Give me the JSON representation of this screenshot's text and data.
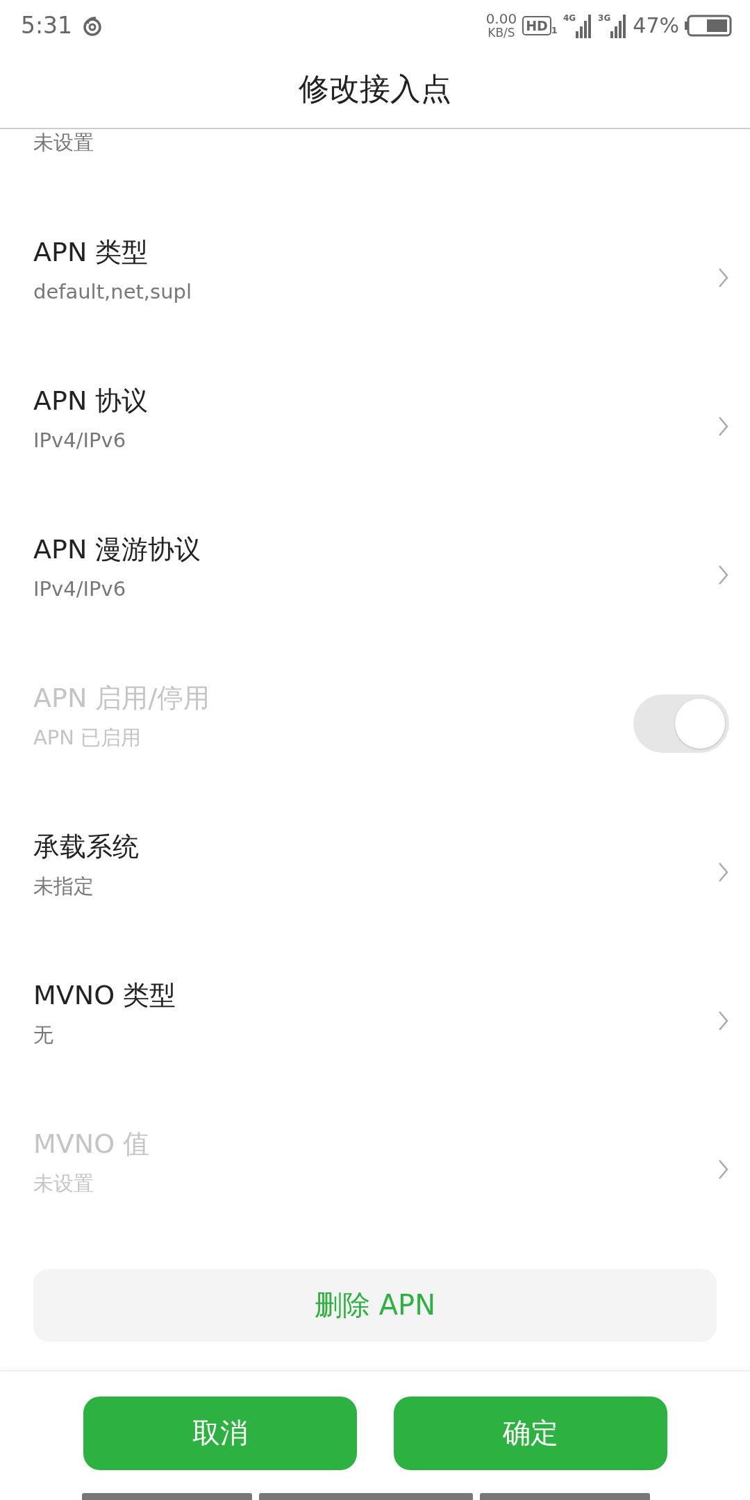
{
  "status_bar": {
    "time": "5:31",
    "speed_value": "0.00",
    "speed_unit": "KB/S",
    "hd": "HD",
    "hd_sim": "1",
    "signals": [
      {
        "label": "4G"
      },
      {
        "label": "3G"
      }
    ],
    "battery": "47%"
  },
  "title": "修改接入点",
  "items": [
    {
      "kind": "partial",
      "subtitle": "未设置",
      "disabled": false
    },
    {
      "kind": "chevron",
      "title": "APN 类型",
      "subtitle": "default,net,supl",
      "disabled": false
    },
    {
      "kind": "chevron",
      "title": "APN 协议",
      "subtitle": "IPv4/IPv6",
      "disabled": false
    },
    {
      "kind": "chevron",
      "title": "APN 漫游协议",
      "subtitle": "IPv4/IPv6",
      "disabled": false
    },
    {
      "kind": "toggle",
      "title": "APN 启用/停用",
      "subtitle": "APN 已启用",
      "disabled": true,
      "on": true
    },
    {
      "kind": "chevron",
      "title": "承载系统",
      "subtitle": "未指定",
      "disabled": false
    },
    {
      "kind": "chevron",
      "title": "MVNO 类型",
      "subtitle": "无",
      "disabled": false
    },
    {
      "kind": "chevron",
      "title": "MVNO 值",
      "subtitle": "未设置",
      "disabled": true
    }
  ],
  "delete_button": "删除 APN",
  "buttons": [
    "取消",
    "确定"
  ]
}
